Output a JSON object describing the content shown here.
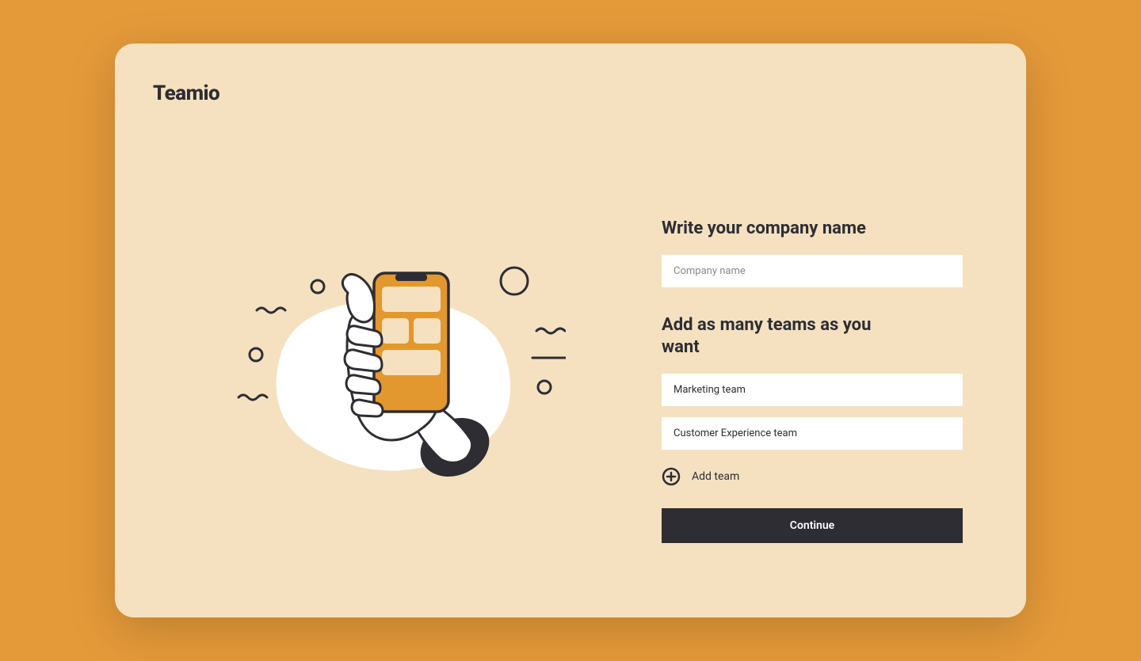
{
  "brand": {
    "name": "Teamio"
  },
  "form": {
    "company": {
      "title": "Write your company name",
      "placeholder": "Company name"
    },
    "teams": {
      "title": "Add as many teams as you want",
      "items": [
        {
          "value": "Marketing team"
        },
        {
          "value": "Customer Experience team"
        }
      ],
      "addLabel": "Add team"
    },
    "submitLabel": "Continue"
  },
  "colors": {
    "background": "#e59a3a",
    "card": "#f5e1c0",
    "dark": "#2d2d33",
    "accent": "#e2982e",
    "white": "#ffffff"
  }
}
